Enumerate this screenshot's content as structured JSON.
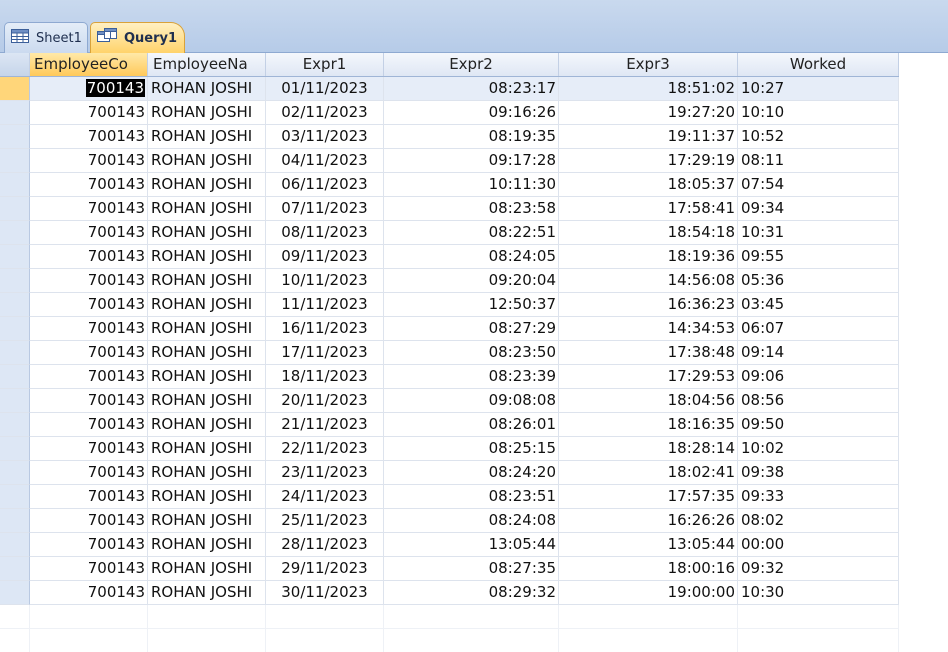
{
  "tabs": [
    {
      "label": "Sheet1",
      "icon": "table-icon",
      "active": false
    },
    {
      "label": "Query1",
      "icon": "query-icon",
      "active": true
    }
  ],
  "columns": [
    "EmployeeCo",
    "EmployeeNa",
    "Expr1",
    "Expr2",
    "Expr3",
    "Worked"
  ],
  "rows": [
    [
      "700143",
      "ROHAN  JOSHI",
      "01/11/2023",
      "08:23:17",
      "18:51:02",
      "10:27"
    ],
    [
      "700143",
      "ROHAN  JOSHI",
      "02/11/2023",
      "09:16:26",
      "19:27:20",
      "10:10"
    ],
    [
      "700143",
      "ROHAN  JOSHI",
      "03/11/2023",
      "08:19:35",
      "19:11:37",
      "10:52"
    ],
    [
      "700143",
      "ROHAN  JOSHI",
      "04/11/2023",
      "09:17:28",
      "17:29:19",
      "08:11"
    ],
    [
      "700143",
      "ROHAN  JOSHI",
      "06/11/2023",
      "10:11:30",
      "18:05:37",
      "07:54"
    ],
    [
      "700143",
      "ROHAN  JOSHI",
      "07/11/2023",
      "08:23:58",
      "17:58:41",
      "09:34"
    ],
    [
      "700143",
      "ROHAN  JOSHI",
      "08/11/2023",
      "08:22:51",
      "18:54:18",
      "10:31"
    ],
    [
      "700143",
      "ROHAN  JOSHI",
      "09/11/2023",
      "08:24:05",
      "18:19:36",
      "09:55"
    ],
    [
      "700143",
      "ROHAN  JOSHI",
      "10/11/2023",
      "09:20:04",
      "14:56:08",
      "05:36"
    ],
    [
      "700143",
      "ROHAN  JOSHI",
      "11/11/2023",
      "12:50:37",
      "16:36:23",
      "03:45"
    ],
    [
      "700143",
      "ROHAN  JOSHI",
      "16/11/2023",
      "08:27:29",
      "14:34:53",
      "06:07"
    ],
    [
      "700143",
      "ROHAN  JOSHI",
      "17/11/2023",
      "08:23:50",
      "17:38:48",
      "09:14"
    ],
    [
      "700143",
      "ROHAN  JOSHI",
      "18/11/2023",
      "08:23:39",
      "17:29:53",
      "09:06"
    ],
    [
      "700143",
      "ROHAN  JOSHI",
      "20/11/2023",
      "09:08:08",
      "18:04:56",
      "08:56"
    ],
    [
      "700143",
      "ROHAN  JOSHI",
      "21/11/2023",
      "08:26:01",
      "18:16:35",
      "09:50"
    ],
    [
      "700143",
      "ROHAN  JOSHI",
      "22/11/2023",
      "08:25:15",
      "18:28:14",
      "10:02"
    ],
    [
      "700143",
      "ROHAN  JOSHI",
      "23/11/2023",
      "08:24:20",
      "18:02:41",
      "09:38"
    ],
    [
      "700143",
      "ROHAN  JOSHI",
      "24/11/2023",
      "08:23:51",
      "17:57:35",
      "09:33"
    ],
    [
      "700143",
      "ROHAN  JOSHI",
      "25/11/2023",
      "08:24:08",
      "16:26:26",
      "08:02"
    ],
    [
      "700143",
      "ROHAN  JOSHI",
      "28/11/2023",
      "13:05:44",
      "13:05:44",
      "00:00"
    ],
    [
      "700143",
      "ROHAN  JOSHI",
      "29/11/2023",
      "08:27:35",
      "18:00:16",
      "09:32"
    ],
    [
      "700143",
      "ROHAN  JOSHI",
      "30/11/2023",
      "08:29:32",
      "19:00:00",
      "10:30"
    ]
  ],
  "active_row": 0,
  "colors": {
    "tab_active": "#ffd36b",
    "header_bg": "#dfe7f4",
    "selection": "#000000",
    "record_selector_active": "#ffd67a"
  }
}
